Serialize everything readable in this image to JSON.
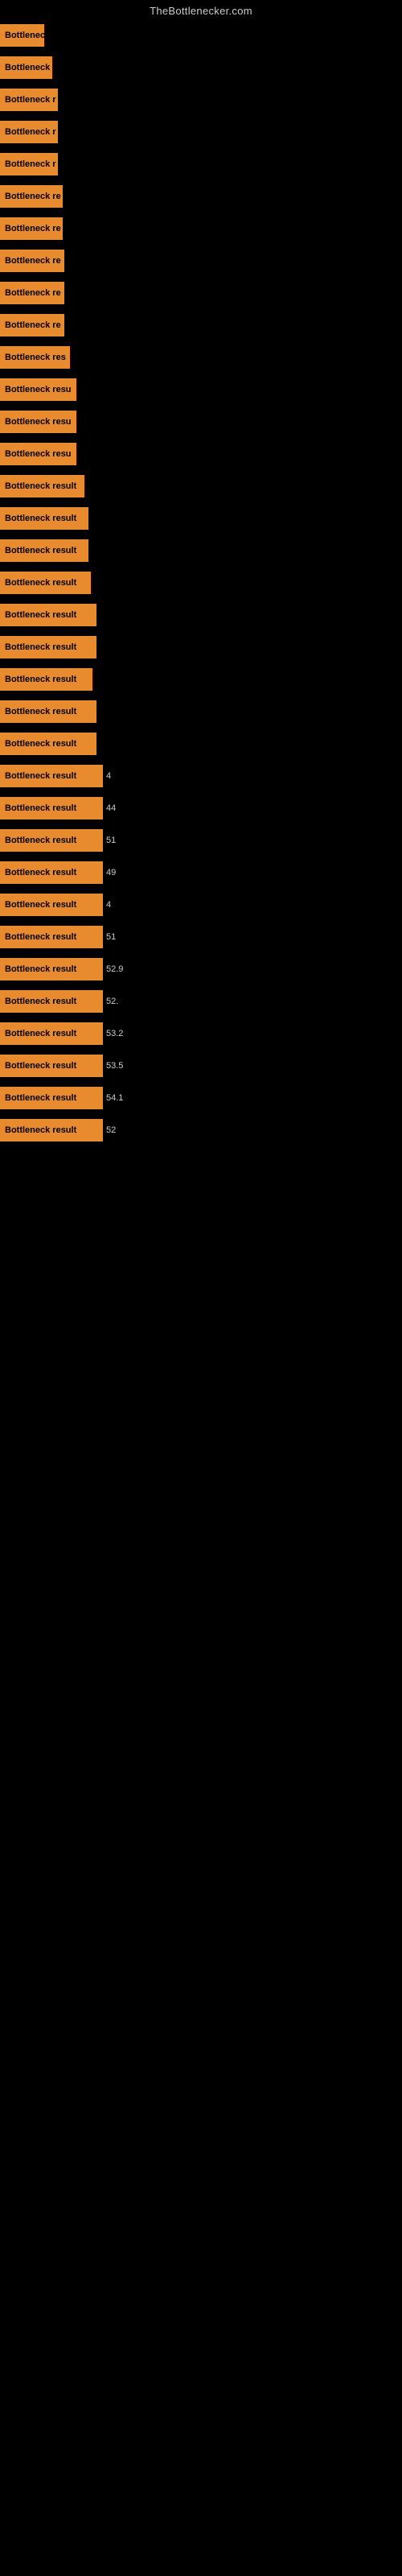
{
  "site_title": "TheBottlenecker.com",
  "rows": [
    {
      "label": "Bottleneck",
      "width": 55,
      "value": ""
    },
    {
      "label": "Bottleneck r",
      "width": 65,
      "value": ""
    },
    {
      "label": "Bottleneck r",
      "width": 72,
      "value": ""
    },
    {
      "label": "Bottleneck r",
      "width": 72,
      "value": ""
    },
    {
      "label": "Bottleneck r",
      "width": 72,
      "value": ""
    },
    {
      "label": "Bottleneck re",
      "width": 78,
      "value": ""
    },
    {
      "label": "Bottleneck re",
      "width": 78,
      "value": ""
    },
    {
      "label": "Bottleneck re",
      "width": 80,
      "value": ""
    },
    {
      "label": "Bottleneck re",
      "width": 80,
      "value": ""
    },
    {
      "label": "Bottleneck re",
      "width": 80,
      "value": ""
    },
    {
      "label": "Bottleneck res",
      "width": 87,
      "value": ""
    },
    {
      "label": "Bottleneck resu",
      "width": 95,
      "value": ""
    },
    {
      "label": "Bottleneck resu",
      "width": 95,
      "value": ""
    },
    {
      "label": "Bottleneck resu",
      "width": 95,
      "value": ""
    },
    {
      "label": "Bottleneck result",
      "width": 105,
      "value": ""
    },
    {
      "label": "Bottleneck result",
      "width": 110,
      "value": ""
    },
    {
      "label": "Bottleneck result",
      "width": 110,
      "value": ""
    },
    {
      "label": "Bottleneck result",
      "width": 113,
      "value": ""
    },
    {
      "label": "Bottleneck result",
      "width": 120,
      "value": ""
    },
    {
      "label": "Bottleneck result",
      "width": 120,
      "value": ""
    },
    {
      "label": "Bottleneck result",
      "width": 115,
      "value": ""
    },
    {
      "label": "Bottleneck result",
      "width": 120,
      "value": ""
    },
    {
      "label": "Bottleneck result",
      "width": 120,
      "value": ""
    },
    {
      "label": "Bottleneck result",
      "width": 128,
      "value": "4"
    },
    {
      "label": "Bottleneck result",
      "width": 128,
      "value": "44"
    },
    {
      "label": "Bottleneck result",
      "width": 128,
      "value": "51"
    },
    {
      "label": "Bottleneck result",
      "width": 128,
      "value": "49"
    },
    {
      "label": "Bottleneck result",
      "width": 128,
      "value": "4"
    },
    {
      "label": "Bottleneck result",
      "width": 128,
      "value": "51"
    },
    {
      "label": "Bottleneck result",
      "width": 128,
      "value": "52.9"
    },
    {
      "label": "Bottleneck result",
      "width": 128,
      "value": "52."
    },
    {
      "label": "Bottleneck result",
      "width": 128,
      "value": "53.2"
    },
    {
      "label": "Bottleneck result",
      "width": 128,
      "value": "53.5"
    },
    {
      "label": "Bottleneck result",
      "width": 128,
      "value": "54.1"
    },
    {
      "label": "Bottleneck result",
      "width": 128,
      "value": "52"
    }
  ]
}
